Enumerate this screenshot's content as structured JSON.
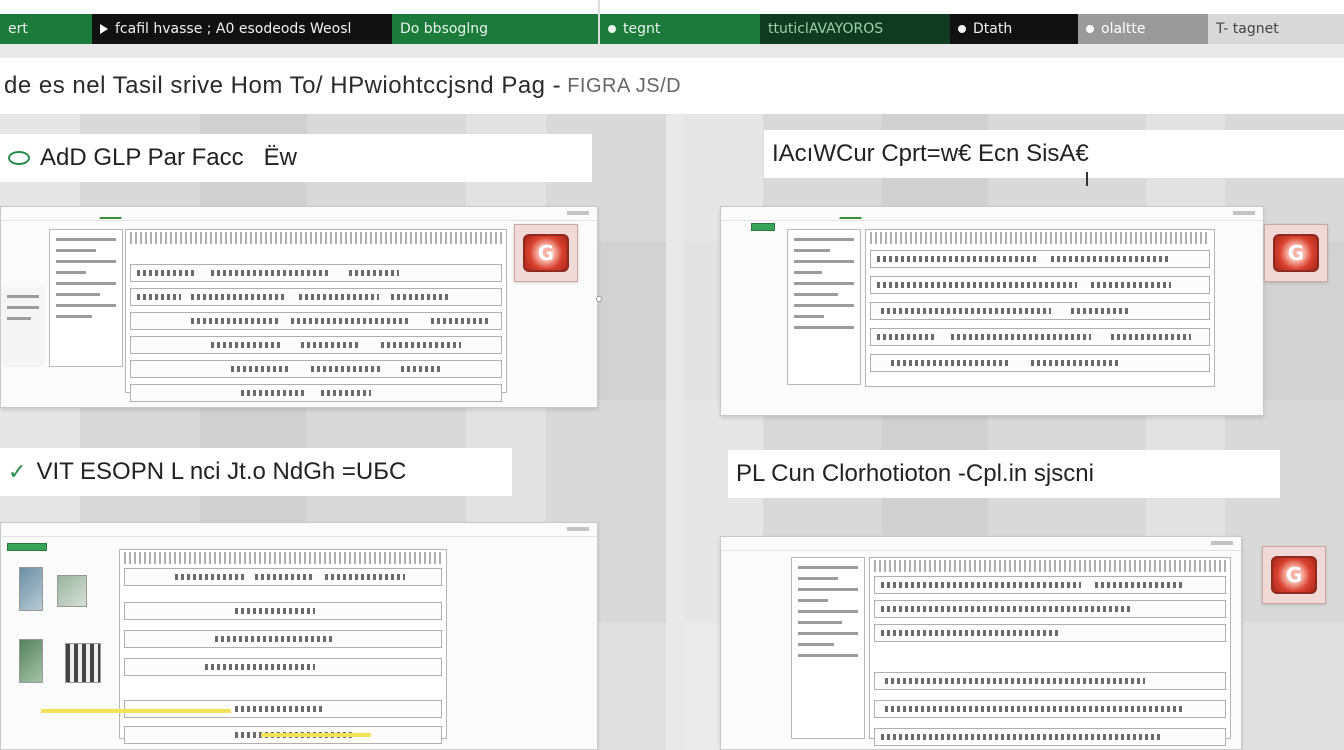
{
  "topbar": {
    "seg1": "еrt",
    "seg2": "fcafil hvasse ;  A0 esodeods  Weosl",
    "seg3": "Do bbsoglng",
    "seg4": "tegnt",
    "seg5": "ttuticlAVAYOROS",
    "seg6": "Dtath",
    "seg7": "olaltte",
    "seg8": "T- tagnet",
    "colors": {
      "green": "#1c7a3a",
      "dark": "#111111",
      "grey": "#9a9a9a"
    }
  },
  "page": {
    "title": "de es nel Tasil srive Hom To/ HPwiohtccjsnd Pag -",
    "title_tail": "FIGRA  JS/D"
  },
  "panels": [
    {
      "heading": "AdD GLP Par Facc   Ёw"
    },
    {
      "heading": "IAсıWCur Cprt=w€ Eсn SisA€"
    },
    {
      "heading": "VIT ESOPN L nci Jt.o NdGh =UБC"
    },
    {
      "heading": "PL Cun Clorhotioton -Cpl.in sjscni"
    }
  ],
  "badge": {
    "glyph": "G",
    "colors": {
      "fill": "#d9412f",
      "border": "#8f2a20"
    }
  }
}
